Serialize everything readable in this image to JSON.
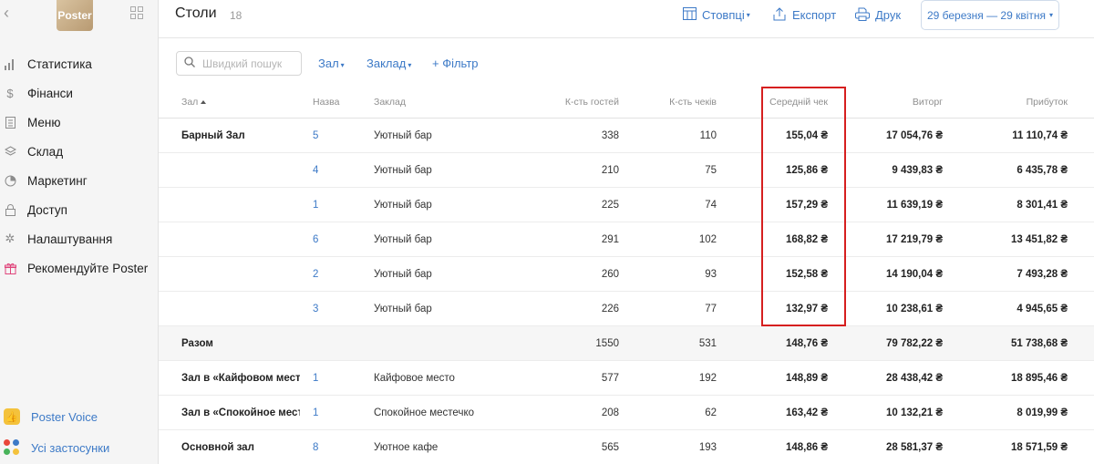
{
  "sidebar": {
    "logo_text": "Poster",
    "items": [
      {
        "icon": "chart-icon",
        "label": "Статистика"
      },
      {
        "icon": "dollar-icon",
        "label": "Фінанси"
      },
      {
        "icon": "document-icon",
        "label": "Меню"
      },
      {
        "icon": "layers-icon",
        "label": "Склад"
      },
      {
        "icon": "pie-icon",
        "label": "Маркетинг"
      },
      {
        "icon": "lock-icon",
        "label": "Доступ"
      },
      {
        "icon": "gear-icon",
        "label": "Налаштування"
      },
      {
        "icon": "gift-icon",
        "label": "Рекомендуйте Poster"
      }
    ],
    "bottom": [
      {
        "label": "Poster Voice"
      },
      {
        "label": "Усі застосунки"
      }
    ]
  },
  "header": {
    "title": "Столи",
    "count": "18",
    "columns_label": "Стовпці",
    "export_label": "Експорт",
    "print_label": "Друк",
    "date_range": "29 березня — 29 квітня"
  },
  "filters": {
    "search_placeholder": "Швидкий пошук",
    "zal": "Зал",
    "zaklad": "Заклад",
    "add_filter": "+ Фільтр"
  },
  "table": {
    "headers": {
      "zal": "Зал",
      "name": "Назва",
      "place": "Заклад",
      "guests": "К-сть гостей",
      "checks": "К-сть чеків",
      "avg": "Середній чек",
      "revenue": "Виторг",
      "profit": "Прибуток"
    },
    "rows": [
      {
        "zal": "Барный Зал",
        "name": "5",
        "place": "Уютный бар",
        "guests": "338",
        "checks": "110",
        "avg": "155,04 ₴",
        "revenue": "17 054,76 ₴",
        "profit": "11 110,74 ₴"
      },
      {
        "zal": "",
        "name": "4",
        "place": "Уютный бар",
        "guests": "210",
        "checks": "75",
        "avg": "125,86 ₴",
        "revenue": "9 439,83 ₴",
        "profit": "6 435,78 ₴"
      },
      {
        "zal": "",
        "name": "1",
        "place": "Уютный бар",
        "guests": "225",
        "checks": "74",
        "avg": "157,29 ₴",
        "revenue": "11 639,19 ₴",
        "profit": "8 301,41 ₴"
      },
      {
        "zal": "",
        "name": "6",
        "place": "Уютный бар",
        "guests": "291",
        "checks": "102",
        "avg": "168,82 ₴",
        "revenue": "17 219,79 ₴",
        "profit": "13 451,82 ₴"
      },
      {
        "zal": "",
        "name": "2",
        "place": "Уютный бар",
        "guests": "260",
        "checks": "93",
        "avg": "152,58 ₴",
        "revenue": "14 190,04 ₴",
        "profit": "7 493,28 ₴"
      },
      {
        "zal": "",
        "name": "3",
        "place": "Уютный бар",
        "guests": "226",
        "checks": "77",
        "avg": "132,97 ₴",
        "revenue": "10 238,61 ₴",
        "profit": "4 945,65 ₴"
      },
      {
        "zal": "Разом",
        "name": "",
        "place": "",
        "guests": "1550",
        "checks": "531",
        "avg": "148,76 ₴",
        "revenue": "79 782,22 ₴",
        "profit": "51 738,68 ₴",
        "total": true
      },
      {
        "zal": "Зал в «Кайфовом месте»",
        "name": "1",
        "place": "Кайфовое место",
        "guests": "577",
        "checks": "192",
        "avg": "148,89 ₴",
        "revenue": "28 438,42 ₴",
        "profit": "18 895,46 ₴"
      },
      {
        "zal": "Зал в «Спокойное местечко»",
        "name": "1",
        "place": "Спокойное местечко",
        "guests": "208",
        "checks": "62",
        "avg": "163,42 ₴",
        "revenue": "10 132,21 ₴",
        "profit": "8 019,99 ₴"
      },
      {
        "zal": "Основной зал",
        "name": "8",
        "place": "Уютное кафе",
        "guests": "565",
        "checks": "193",
        "avg": "148,86 ₴",
        "revenue": "28 581,37 ₴",
        "profit": "18 571,59 ₴"
      }
    ]
  },
  "colors": {
    "accent": "#3d7ac7",
    "highlight_box": "#d61f1f"
  }
}
